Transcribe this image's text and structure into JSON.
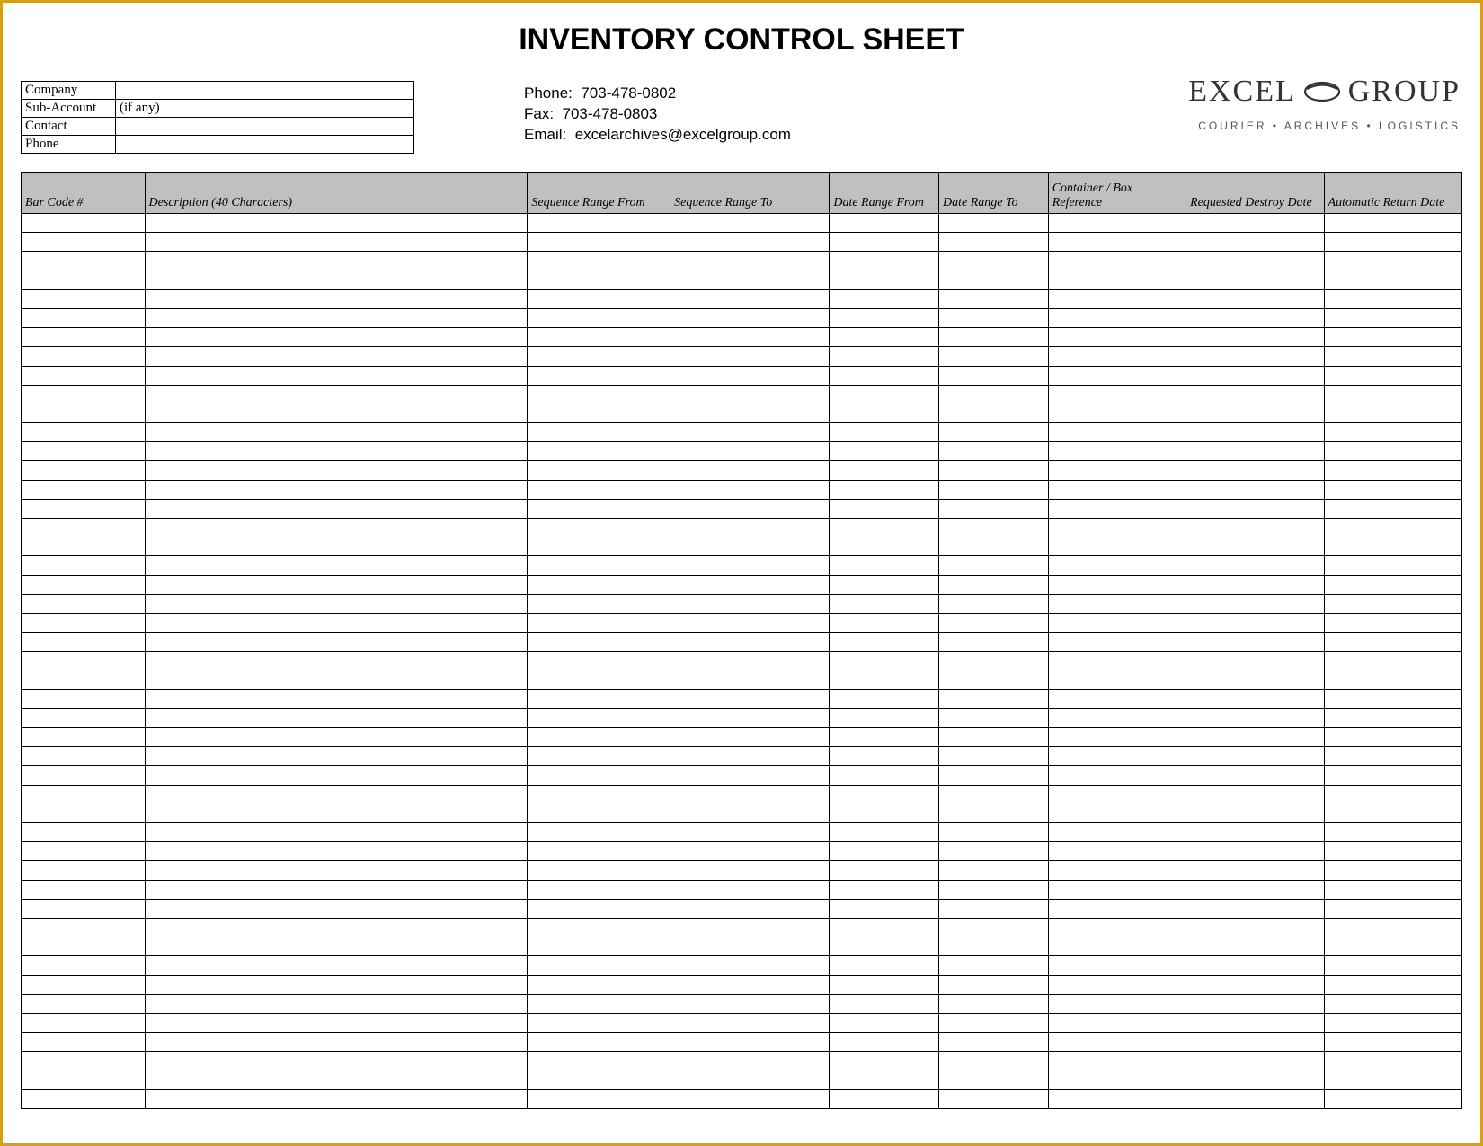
{
  "title": "INVENTORY CONTROL SHEET",
  "meta": {
    "labels": {
      "company": "Company",
      "subaccount": "Sub-Account",
      "contact": "Contact",
      "phone": "Phone"
    },
    "values": {
      "company": "",
      "subaccount": "(if any)",
      "contact": "",
      "phone": ""
    }
  },
  "contact": {
    "phone_label": "Phone:",
    "phone": "703-478-0802",
    "fax_label": "Fax:",
    "fax": "703-478-0803",
    "email_label": "Email:",
    "email": "excelarchives@excelgroup.com"
  },
  "brand": {
    "word1": "EXCEL",
    "word2": "GROUP",
    "tagline": "COURIER • ARCHIVES • LOGISTICS"
  },
  "columns": {
    "barcode": "Bar Code #",
    "description": "Description (40 Characters)",
    "seq_from": "Sequence Range From",
    "seq_to": "Sequence Range To",
    "date_from": "Date Range From",
    "date_to": "Date Range To",
    "container": "Container / Box Reference",
    "req_destroy": "Requested Destroy Date",
    "auto_return": "Automatic Return Date"
  },
  "row_count": 47
}
